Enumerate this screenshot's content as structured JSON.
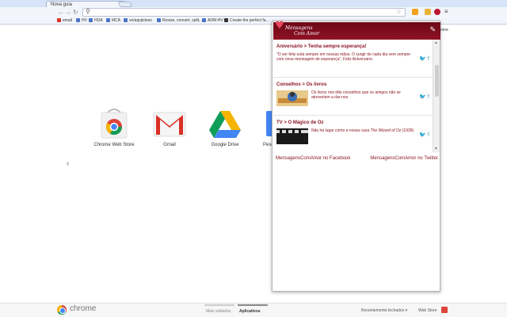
{
  "window": {
    "tab_title": "Nova guia"
  },
  "bookmarks": [
    {
      "label": "email",
      "color": "#d93025"
    },
    {
      "label": "HV",
      "color": "#4a74c9"
    },
    {
      "label": "HDA",
      "color": "#4a74c9"
    },
    {
      "label": "MCA",
      "color": "#4a74c9"
    },
    {
      "label": "vo/aqvjicteso",
      "color": "#4a74c9"
    },
    {
      "label": "Resize, convert, split, ...",
      "color": "#4a74c9"
    },
    {
      "label": "ADM-HV",
      "color": "#4a74c9"
    },
    {
      "label": "Create the perfect fa...",
      "color": "#333333"
    }
  ],
  "apps": [
    {
      "label": "Chrome Web Store",
      "icon": "chrome-web-store-icon"
    },
    {
      "label": "Gmail",
      "icon": "gmail-icon"
    },
    {
      "label": "Google Drive",
      "icon": "google-drive-icon"
    },
    {
      "label": "Pesq",
      "icon": "search-app-icon"
    }
  ],
  "popup": {
    "brand_line1": "Mensagens",
    "brand_line2": "Com Amor",
    "posts": [
      {
        "title": "Aniversário > Tenha sempre esperança!",
        "text": "\"O ser feliz está sempre em nossas mãos. O surgir de cada dia vem sempre com nova mensagem de esperança\". Feliz Aniversário."
      },
      {
        "title": "Conselhos > Os livros",
        "text": "Os livros nos dão conselhos que os amigos não se atreveriam a dar-nos."
      },
      {
        "title": "TV > O Mágico de Oz",
        "text_before": "Não há lugar como a nossa casa ",
        "text_italic": "The Wizard of Oz",
        "text_after": " (1939)"
      }
    ],
    "facebook_link": "MensagensComAmor no Facebook",
    "twitter_link": "MensagensComAmor no Twitter"
  },
  "page_side_text": "ome",
  "footer": {
    "logo_text": "chrome",
    "tab_most_visited": "Mais visitados",
    "tab_apps": "Aplicativos",
    "recently_closed": "Recentemente fechados",
    "web_store": "Web Store"
  },
  "colors": {
    "accent": "#8b1524",
    "header_bg": "#7a0c1c"
  }
}
